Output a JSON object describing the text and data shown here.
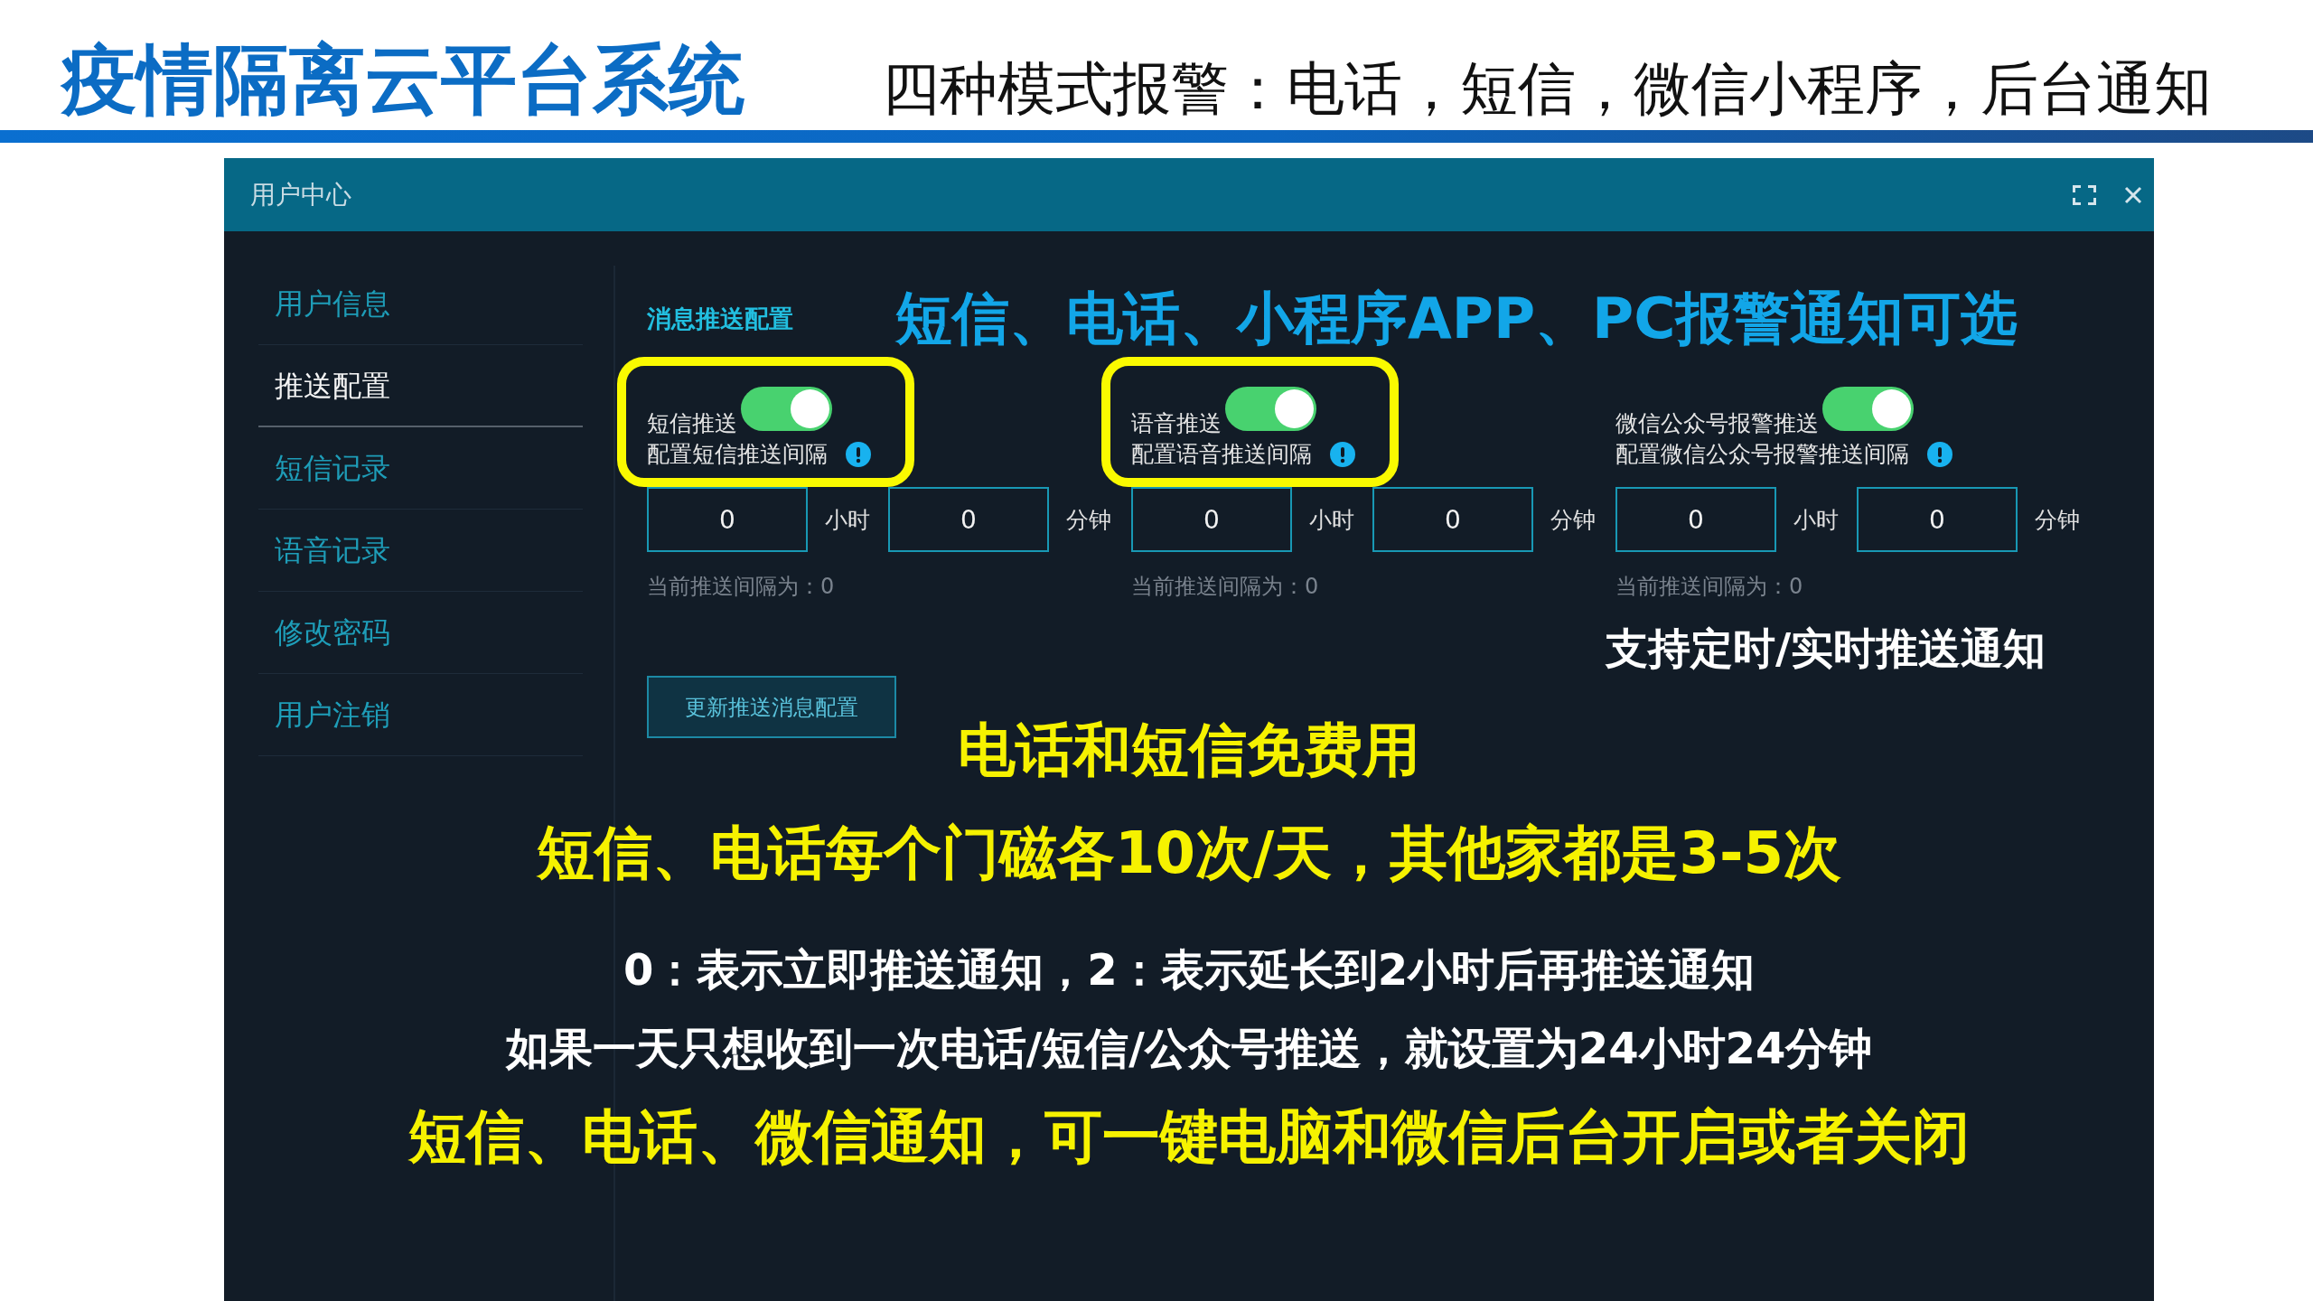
{
  "header": {
    "title": "疫情隔离云平台系统",
    "subtitle": "四种模式报警：电话，短信，微信小程序，后台通知"
  },
  "window": {
    "title": "用户中心"
  },
  "sidebar": {
    "items": [
      {
        "label": "用户信息",
        "selected": false
      },
      {
        "label": "推送配置",
        "selected": true
      },
      {
        "label": "短信记录",
        "selected": false
      },
      {
        "label": "语音记录",
        "selected": false
      },
      {
        "label": "修改密码",
        "selected": false
      },
      {
        "label": "用户注销",
        "selected": false
      }
    ]
  },
  "push_config": {
    "heading": "消息推送配置",
    "callout": "短信、电话、小程序APP、PC报警通知可选",
    "channels": [
      {
        "label": "短信推送",
        "on": true,
        "highlighted": true,
        "interval_label": "配置短信推送间隔",
        "hours": "0",
        "hours_unit": "小时",
        "minutes": "0",
        "minutes_unit": "分钟",
        "current_interval": "当前推送间隔为：0"
      },
      {
        "label": "语音推送",
        "on": true,
        "highlighted": true,
        "interval_label": "配置语音推送间隔",
        "hours": "0",
        "hours_unit": "小时",
        "minutes": "0",
        "minutes_unit": "分钟",
        "current_interval": "当前推送间隔为：0"
      },
      {
        "label": "微信公众号报警推送",
        "on": true,
        "highlighted": false,
        "interval_label": "配置微信公众号报警推送间隔",
        "hours": "0",
        "hours_unit": "小时",
        "minutes": "0",
        "minutes_unit": "分钟",
        "current_interval": "当前推送间隔为：0"
      }
    ],
    "timing_note": "支持定时/实时推送通知",
    "update_button": "更新推送消息配置"
  },
  "notes": [
    {
      "kind": "highlight",
      "text": "电话和短信免费用"
    },
    {
      "kind": "highlight",
      "text": "短信、电话每个门磁各10次/天，其他家都是3-5次"
    },
    {
      "kind": "plain",
      "text": "0：表示立即推送通知，2：表示延长到2小时后再推送通知"
    },
    {
      "kind": "plain",
      "text": "如果一天只想收到一次电话/短信/公众号推送，就设置为24小时24分钟"
    },
    {
      "kind": "highlight",
      "text": "短信、电话、微信通知，可一键电脑和微信后台开启或者关闭"
    }
  ]
}
